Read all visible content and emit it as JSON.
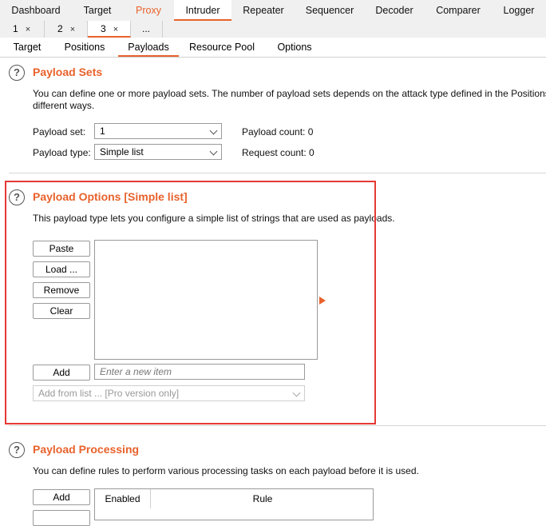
{
  "tool_tabs": [
    "Dashboard",
    "Target",
    "Proxy",
    "Intruder",
    "Repeater",
    "Sequencer",
    "Decoder",
    "Comparer",
    "Logger"
  ],
  "instance_tabs": [
    "1",
    "2",
    "3",
    "..."
  ],
  "close_glyph": "×",
  "sub_tabs": [
    "Target",
    "Positions",
    "Payloads",
    "Resource Pool",
    "Options"
  ],
  "payload_sets": {
    "title": "Payload Sets",
    "description_line1": "You can define one or more payload sets. The number of payload sets depends on the attack type defined in the Positions t",
    "description_line2": "different ways.",
    "payload_set_label": "Payload set:",
    "payload_set_value": "1",
    "payload_type_label": "Payload type:",
    "payload_type_value": "Simple list",
    "payload_count": "Payload count:  0",
    "request_count": "Request count:  0"
  },
  "payload_options": {
    "title": "Payload Options [Simple list]",
    "description": "This payload type lets you configure a simple list of strings that are used as payloads.",
    "buttons": {
      "paste": "Paste",
      "load": "Load ...",
      "remove": "Remove",
      "clear": "Clear",
      "add": "Add"
    },
    "new_item_placeholder": "Enter a new item",
    "add_from_list": "Add from list ... [Pro version only]"
  },
  "payload_processing": {
    "title": "Payload Processing",
    "description": "You can define rules to perform various processing tasks on each payload before it is used.",
    "add_button": "Add",
    "columns": [
      "Enabled",
      "Rule"
    ]
  },
  "colors": {
    "accent": "#e8622c",
    "highlight_box": "#e53935"
  },
  "icons": [
    "help-icon",
    "chevron-down-icon",
    "close-icon",
    "arrow-right-icon"
  ]
}
